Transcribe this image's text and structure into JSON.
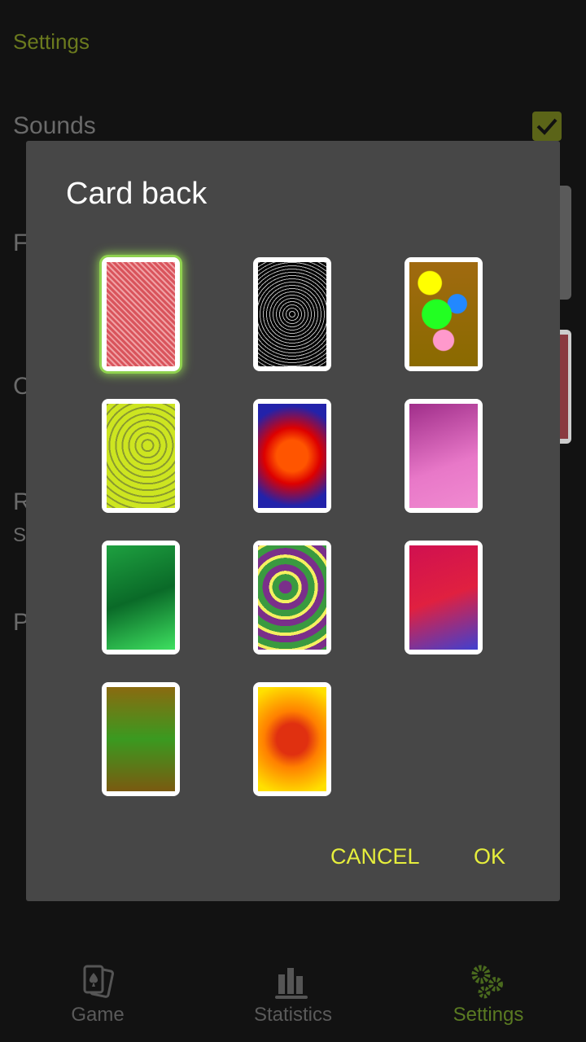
{
  "settings": {
    "header": "Settings",
    "sounds_label": "Sounds",
    "sounds_checked": true,
    "partial_labels": [
      "F",
      "C",
      "R",
      "S",
      "P"
    ]
  },
  "dialog": {
    "title": "Card back",
    "selected_index": 0,
    "cards": [
      {
        "name": "red-classic",
        "bg": "repeating-linear-gradient(45deg,#d9545c 0 3px,#f0a0a4 3px 5px)"
      },
      {
        "name": "black-classic",
        "bg": "repeating-radial-gradient(circle at 50% 50%,#000 0 3px,#bbb 3px 4px)"
      },
      {
        "name": "bubbles",
        "bg": "radial-gradient(circle at 30% 20%,#ff0 0 12%,transparent 13%),radial-gradient(circle at 40% 50%,#2f2 0 22%,transparent 23%),radial-gradient(circle at 70% 40%,#28f 0 12%,transparent 13%),radial-gradient(circle at 50% 75%,#f9c 0 12%,transparent 13%),linear-gradient(#a06a10,#8a6a00)"
      },
      {
        "name": "yellow-circles",
        "bg": "repeating-radial-gradient(circle at 60% 40%,#cde520 0 6px,#8a9a30 6px 8px)"
      },
      {
        "name": "rainbow-circles",
        "bg": "radial-gradient(circle at 50% 50%,#f50 0 25%,#d00 45%,#22a 80%)"
      },
      {
        "name": "pink-butterflies",
        "bg": "linear-gradient(160deg,#a02e8a,#e878c8 60%,#f08ad0)"
      },
      {
        "name": "green-butterflies",
        "bg": "linear-gradient(160deg,#1ea040,#0a6a28 50%,#3ee060)"
      },
      {
        "name": "daisies",
        "bg": "repeating-radial-gradient(circle at 40% 40%,#7a2f8a 0 8px,#3a9a40 8px 16px,#f5f060 16px 20px)"
      },
      {
        "name": "red-flowers",
        "bg": "linear-gradient(160deg,#d01050,#e02040 50%,#4040d0)"
      },
      {
        "name": "green-dragon",
        "bg": "linear-gradient(#8a6a10,#3a9a20 50%,#7a5a10)"
      },
      {
        "name": "orange-sun",
        "bg": "radial-gradient(circle at 50% 50%,#e03010 0 25%,#ff8000 45%,#ffe000 90%)"
      }
    ],
    "cancel_label": "CANCEL",
    "ok_label": "OK"
  },
  "nav": {
    "tabs": [
      {
        "label": "Game",
        "icon": "cards-icon"
      },
      {
        "label": "Statistics",
        "icon": "bar-chart-icon"
      },
      {
        "label": "Settings",
        "icon": "gears-icon"
      }
    ],
    "active": 2
  },
  "colors": {
    "accent": "#e6ee3c",
    "active_tab": "#5a7a22",
    "dialog_bg": "#474747"
  }
}
